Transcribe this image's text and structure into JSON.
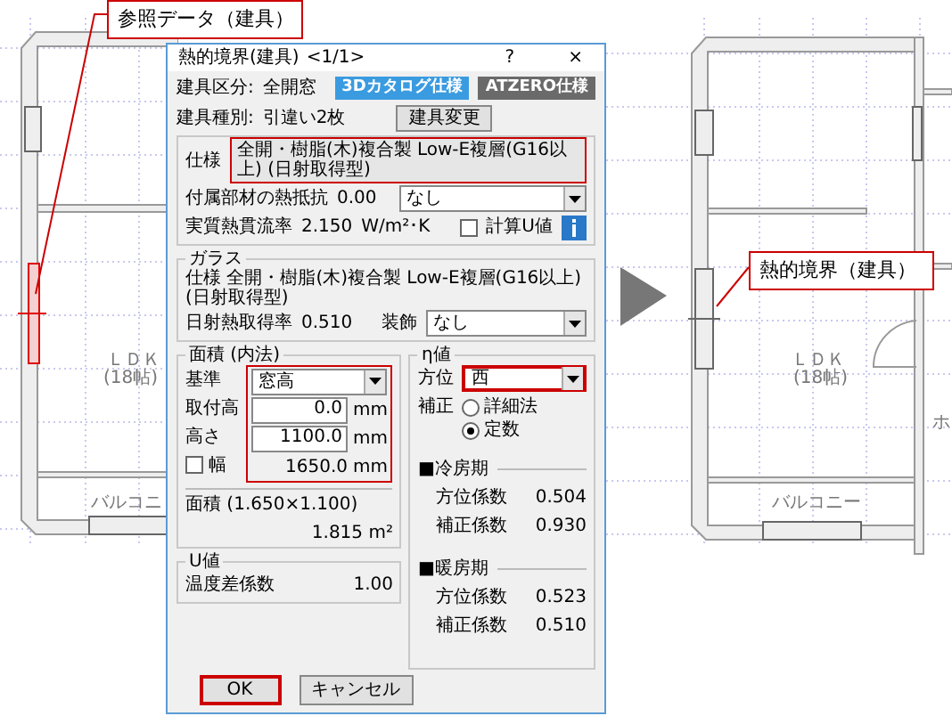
{
  "left_plan": {
    "callout": "参照データ（建具）",
    "room": "ＬＤＫ",
    "room_size": "(18帖)",
    "balcony": "バルコニ"
  },
  "right_plan": {
    "callout": "熱的境界（建具）",
    "room": "ＬＤＫ",
    "room_size": "(18帖)",
    "balcony": "バルコニー",
    "next_room": "ホ"
  },
  "dialog": {
    "title": "熱的境界(建具)",
    "page": "<1/1>",
    "help": "?",
    "close": "×",
    "fitting_class": {
      "label": "建具区分:",
      "value": "全開窓"
    },
    "spec_modes": [
      {
        "label": "3Dカタログ仕様",
        "selected": true
      },
      {
        "label": "ATZERO仕様",
        "selected": false
      }
    ],
    "fitting_type": {
      "label": "建具種別:",
      "value": "引違い2枚"
    },
    "change_button": "建具変更",
    "spec": {
      "label": "仕様",
      "value": "全開・樹脂(木)複合製 Low-E複層(G16以上) (日射取得型)",
      "highlight": true
    },
    "accessory": {
      "label": "付属部材の熱抵抗",
      "value": "0.00",
      "select": "なし"
    },
    "u_value": {
      "label": "実質熱貫流率",
      "value": "2.150",
      "unit": "W/m²･K"
    },
    "calc_u": {
      "label": "計算U値",
      "checked": false
    },
    "glass": {
      "title": "ガラス",
      "spec_label": "仕様",
      "spec": "全開・樹脂(木)複合製 Low-E複層(G16以上) (日射取得型)",
      "solar_label": "日射熱取得率",
      "solar": "0.510",
      "decoration_label": "装飾",
      "decoration": "なし"
    },
    "area": {
      "title": "面積 (内法)",
      "highlight": true,
      "basis_label": "基準",
      "basis": "窓高",
      "rows": [
        {
          "kind": "input",
          "label": "取付高",
          "value": "0.0",
          "unit": "mm"
        },
        {
          "kind": "input",
          "label": "高さ",
          "value": "1100.0",
          "unit": "mm"
        },
        {
          "kind": "check",
          "label": "幅",
          "checked": false,
          "value": "1650.0",
          "unit": "mm"
        }
      ],
      "total_label": "面積 (1.650×1.100)",
      "total": "1.815",
      "total_unit": "m²"
    },
    "u_group": {
      "title": "U値",
      "label": "温度差係数",
      "value": "1.00"
    },
    "eta": {
      "title": "η値",
      "direction_label": "方位",
      "direction": "西",
      "direction_highlight": true,
      "correction_label": "補正",
      "corrections": [
        {
          "label": "詳細法",
          "selected": false
        },
        {
          "label": "定数",
          "selected": true
        }
      ],
      "periods": [
        {
          "title": "■冷房期",
          "rows": [
            {
              "label": "方位係数",
              "value": "0.504"
            },
            {
              "label": "補正係数",
              "value": "0.930"
            }
          ]
        },
        {
          "title": "■暖房期",
          "rows": [
            {
              "label": "方位係数",
              "value": "0.523"
            },
            {
              "label": "補正係数",
              "value": "0.510"
            }
          ]
        }
      ]
    },
    "buttons": [
      {
        "label": "OK",
        "highlight": true
      },
      {
        "label": "キャンセル",
        "highlight": false
      }
    ]
  }
}
